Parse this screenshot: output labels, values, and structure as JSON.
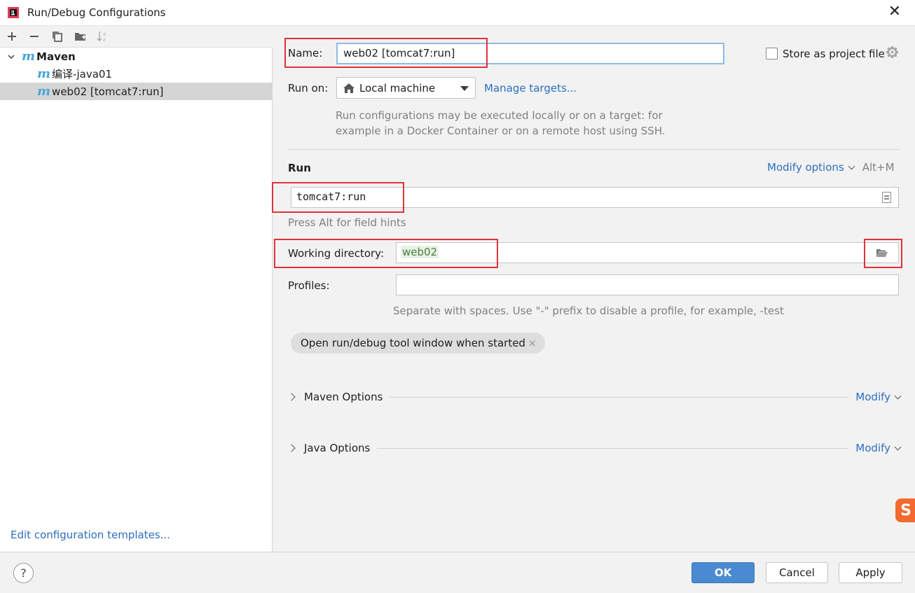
{
  "window": {
    "title": "Run/Debug Configurations",
    "close_glyph": "✕"
  },
  "left": {
    "toolbar": [
      "add-icon",
      "remove-icon",
      "copy-icon",
      "new-folder-icon",
      "sort-icon"
    ],
    "tree": {
      "group_label": "Maven",
      "items": [
        {
          "label": "编译-java01",
          "selected": false
        },
        {
          "label": "web02 [tomcat7:run]",
          "selected": true
        }
      ]
    },
    "edit_templates_link": "Edit configuration templates..."
  },
  "form": {
    "name_label": "Name:",
    "name_value": "web02 [tomcat7:run]",
    "store_as_project_file_label": "Store as project file",
    "store_as_project_file_checked": false,
    "run_on_label": "Run on:",
    "run_on_value": "Local machine",
    "manage_targets_link": "Manage targets...",
    "run_on_hint_line1": "Run configurations may be executed locally or on a target: for",
    "run_on_hint_line2": "example in a Docker Container or on a remote host using SSH.",
    "run_section_title": "Run",
    "modify_options_link": "Modify options",
    "modify_options_shortcut": "Alt+M",
    "command_line_value": "tomcat7:run",
    "field_hints_text": "Press Alt for field hints",
    "working_directory_label": "Working directory:",
    "working_directory_value": "web02",
    "profiles_label": "Profiles:",
    "profiles_value": "",
    "profiles_hint": "Separate with spaces. Use \"-\" prefix to disable a profile, for example, -test",
    "chip_label": "Open run/debug tool window when started",
    "chip_close_glyph": "×",
    "maven_options_label": "Maven Options",
    "java_options_label": "Java Options",
    "modify_label": "Modify"
  },
  "footer": {
    "help_glyph": "?",
    "ok_label": "OK",
    "cancel_label": "Cancel",
    "apply_label": "Apply"
  },
  "badge": {
    "glyph": "S"
  },
  "colors": {
    "accent_link": "#2c6fbf",
    "primary_button": "#4a8ad0",
    "highlight_box": "#e0323a",
    "maven_icon": "#48a7d6",
    "sogou_badge": "#f26a2e"
  }
}
